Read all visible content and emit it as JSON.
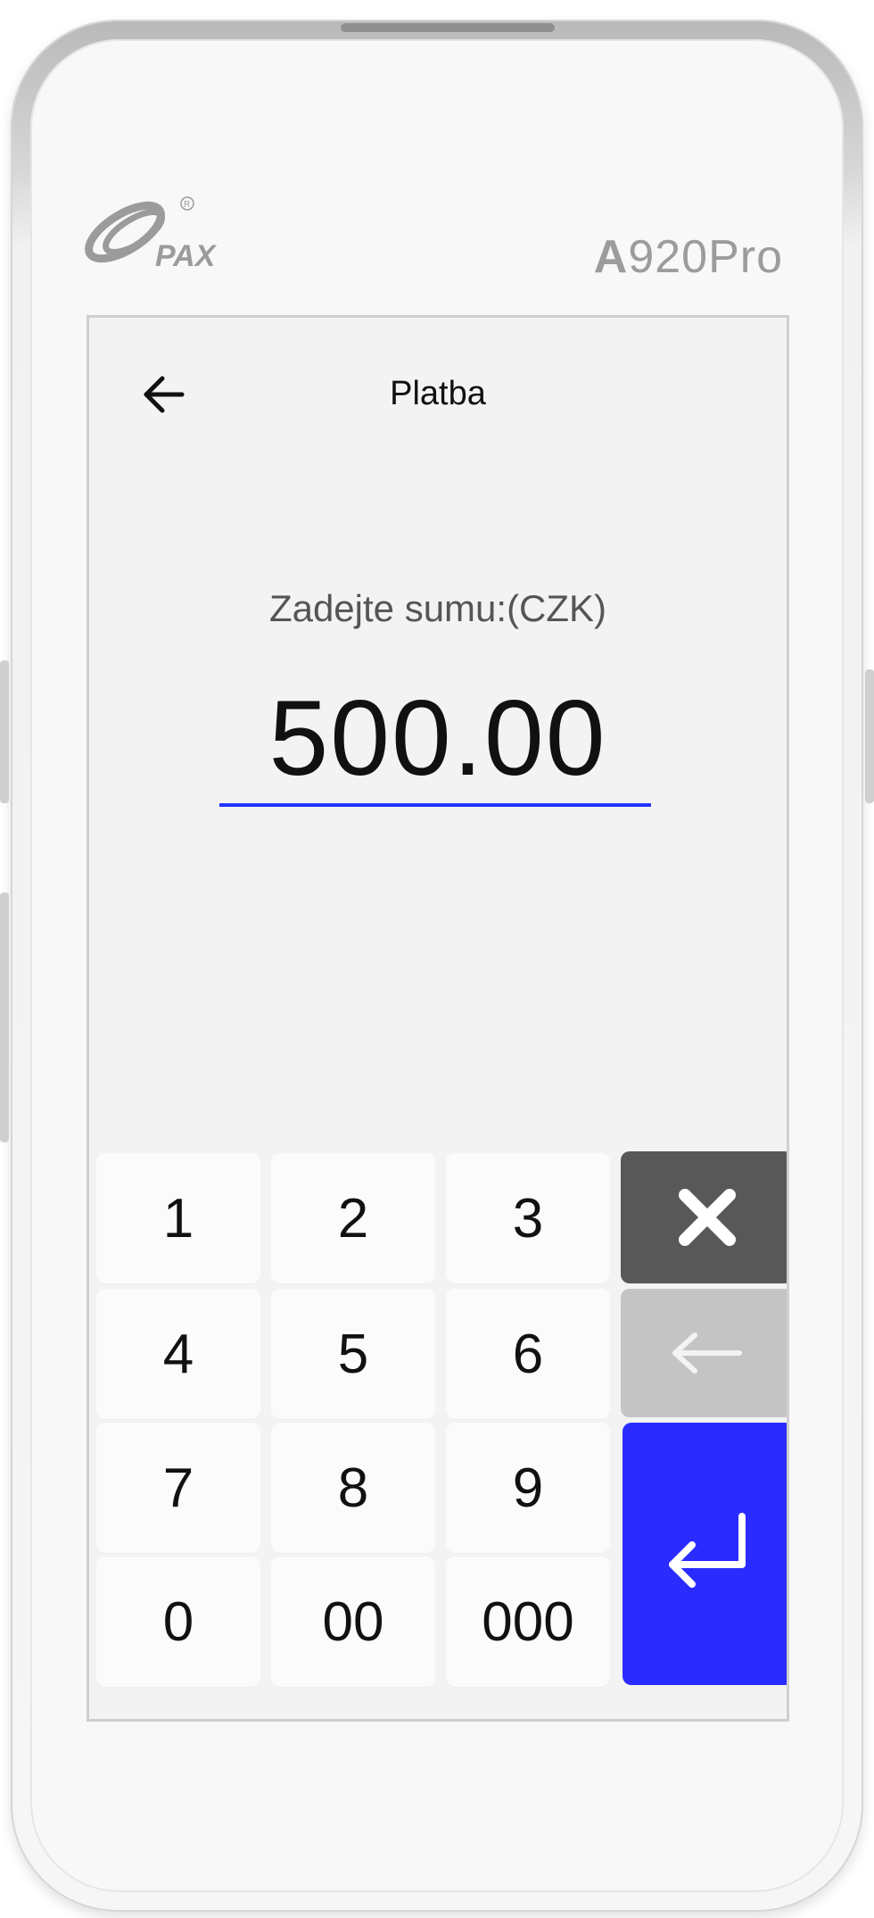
{
  "device": {
    "brand": "PAX",
    "model_prefix": "A",
    "model_suffix": "920Pro"
  },
  "header": {
    "title": "Platba"
  },
  "payment": {
    "prompt": "Zadejte sumu:(CZK)",
    "amount": "500.00"
  },
  "keypad": {
    "keys": [
      "1",
      "2",
      "3",
      "4",
      "5",
      "6",
      "7",
      "8",
      "9",
      "0",
      "00",
      "000"
    ],
    "cancel_icon": "close-icon",
    "backspace_icon": "backspace-arrow-icon",
    "enter_icon": "enter-return-icon"
  },
  "colors": {
    "accent": "#2a2cff",
    "cancel_bg": "#585858",
    "backspace_bg": "#c4c4c4",
    "underline": "#2233ff"
  }
}
